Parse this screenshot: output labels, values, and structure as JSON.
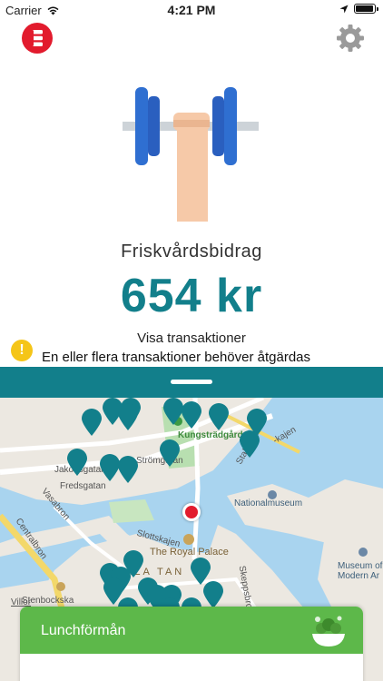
{
  "status_bar": {
    "carrier": "Carrier",
    "time": "4:21 PM",
    "battery_level": 0.95
  },
  "header": {
    "logo_icon": "edenred-logo-icon",
    "settings_icon": "gear-icon"
  },
  "benefit": {
    "illustration_icon": "dumbbell-hand-icon",
    "title": "Friskvårdsbidrag",
    "amount": "654 kr",
    "transactions_link": "Visa transaktioner",
    "warning_icon": "exclamation-icon",
    "warning_text": "En eller flera transaktioner behöver åtgärdas"
  },
  "map": {
    "labels": {
      "kungstradgarden": "Kungsträdgården",
      "jakob": "Jakobsgatan",
      "fredsgatan": "Fredsgatan",
      "strommgatan": "Strömgatan",
      "stallgatan": "Stallgatan",
      "kajen": "-kajen",
      "nationalmuseum": "Nationalmuseum",
      "vasabron": "Vasabron",
      "centralbron": "Centralbron",
      "slottskajen": "Slottskajen",
      "royal_palace": "The Royal Palace",
      "skeppsbron": "Skeppsbron",
      "museum": "Museum of Modern Ar",
      "stenbockska": "Stenbockska",
      "gamla_stan": "ALA TAN",
      "villor": "Villor"
    }
  },
  "lunch_card": {
    "title": "Lunchförmån",
    "icon": "salad-bowl-icon"
  },
  "colors": {
    "teal": "#127f8b",
    "green": "#5db84a",
    "red": "#e21b2d",
    "warning": "#f5c518"
  }
}
